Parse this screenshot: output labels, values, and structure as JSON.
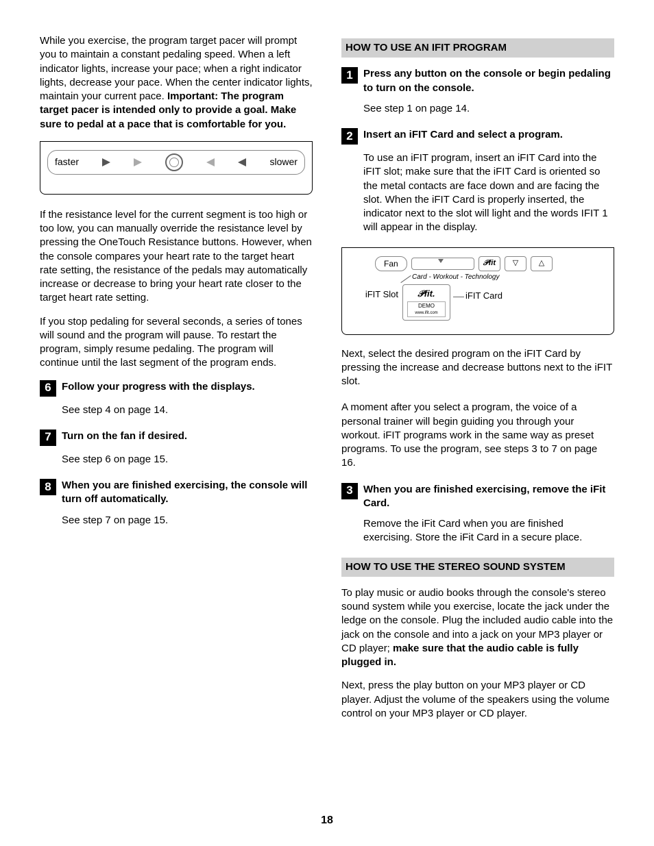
{
  "page_number": "18",
  "left": {
    "para1_a": "While you exercise, the program target pacer will prompt you to maintain a constant pedaling speed. When a left indicator lights, increase your pace; when a right indicator lights, decrease your pace. When the center indicator lights, maintain your current pace. ",
    "para1_b": "Important: The program target pacer is intended only to provide a goal. Make sure to pedal at a pace that is comfortable for you.",
    "pacer": {
      "faster": "faster",
      "slower": "slower"
    },
    "para2": "If the resistance level for the current segment is too high or too low, you can manually override the resistance level by pressing the OneTouch Resistance buttons. However, when the console compares your heart rate to the target heart rate setting, the resistance of the pedals may automatically increase or decrease to bring your heart rate closer to the target heart rate setting.",
    "para3": "If you stop pedaling for several seconds, a series of tones will sound and the program will pause. To restart the program, simply resume pedaling. The program will continue until the last segment of the program ends.",
    "step6": {
      "num": "6",
      "title": "Follow your progress with the displays.",
      "body": "See step 4 on page 14."
    },
    "step7": {
      "num": "7",
      "title": "Turn on the fan if desired.",
      "body": "See step 6 on page 15."
    },
    "step8": {
      "num": "8",
      "title": "When you are finished exercising, the console will turn off automatically.",
      "body": "See step 7 on page 15."
    }
  },
  "right": {
    "header1": "HOW TO USE AN IFIT PROGRAM",
    "step1": {
      "num": "1",
      "title": "Press any button on the console or begin pedaling to turn on the console.",
      "body": "See step 1 on page 14."
    },
    "step2": {
      "num": "2",
      "title": "Insert an iFIT Card and select a program.",
      "body1": "To use an iFIT program, insert an iFIT Card into the iFIT slot; make sure that the iFIT Card is oriented so the metal contacts are face down and are facing the slot. When the iFIT Card is properly inserted, the indicator next to the slot will light and the words IFIT 1 will appear in the display.",
      "diagram": {
        "fan": "Fan",
        "logo": "𝒫fit",
        "tag": "Card - Workout - Technology",
        "slot": "iFIT Slot",
        "card_logo": "𝒫fit.",
        "demo": "DEMO",
        "url": "www.ifit.com",
        "card": "iFIT Card"
      },
      "body2": "Next, select the desired program on the iFIT Card by pressing the increase and decrease buttons next to the iFIT slot.",
      "body3": "A moment after you select a program, the voice of a personal trainer will begin guiding you through your workout. iFIT programs work in the same way as preset programs. To use the program, see steps 3 to 7 on page 16."
    },
    "step3": {
      "num": "3",
      "title": "When you are finished exercising, remove the iFit Card.",
      "body": "Remove the iFit Card when you are finished exercising. Store the iFit Card in a secure place."
    },
    "header2": "HOW TO USE THE STEREO SOUND SYSTEM",
    "stereo_p1_a": "To play music or audio books through the console's stereo sound system while you exercise, locate the jack under the ledge on the console. Plug the included audio cable into the jack on the console and into a jack on your MP3 player or CD player; ",
    "stereo_p1_b": "make sure that the audio cable is fully plugged in.",
    "stereo_p2": "Next, press the play button on your MP3 player or CD player. Adjust the volume of the speakers using the volume control on your MP3 player or CD player."
  }
}
